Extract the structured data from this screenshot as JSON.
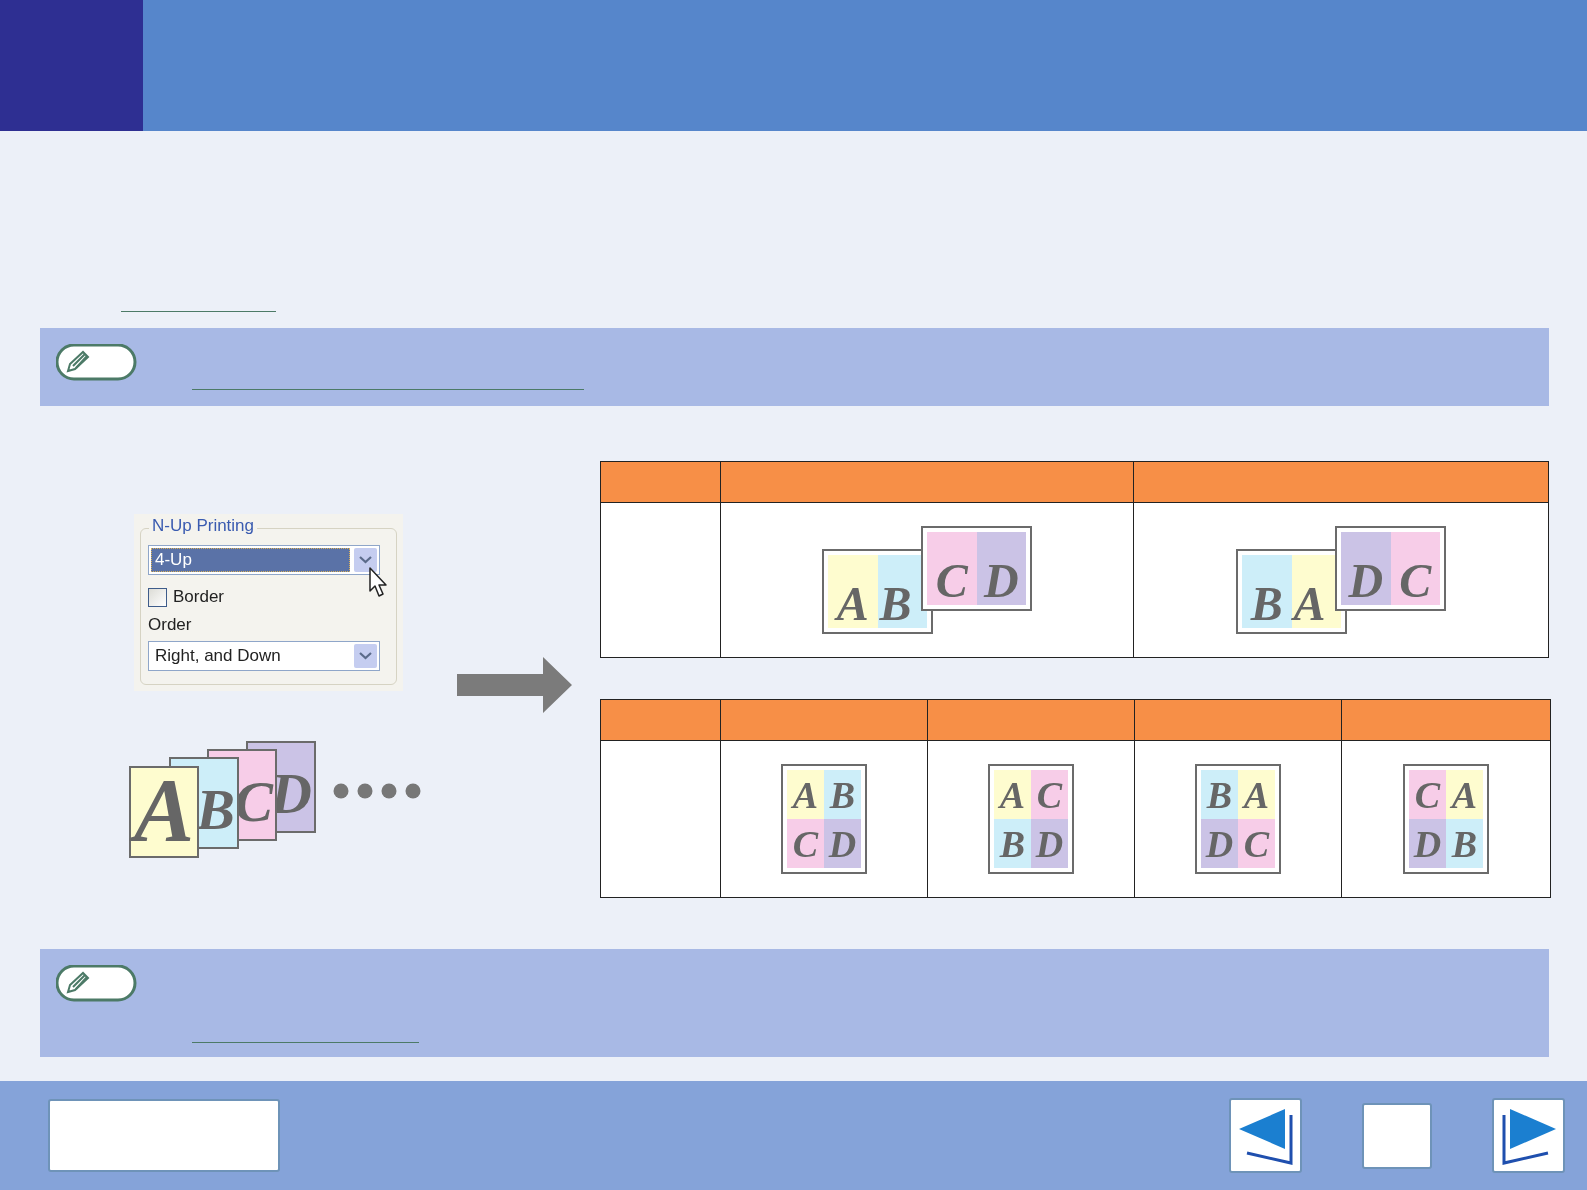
{
  "dialog": {
    "legend": "N-Up Printing",
    "n_up": {
      "value": "4-Up"
    },
    "border": {
      "label": "Border",
      "checked": false
    },
    "order_label": "Order",
    "order": {
      "value": "Right, and Down"
    }
  },
  "stack": [
    {
      "letter": "A",
      "color": "#fefccf"
    },
    {
      "letter": "B",
      "color": "#cdeef9"
    },
    {
      "letter": "C",
      "color": "#f7cde8"
    },
    {
      "letter": "D",
      "color": "#cbc3e6"
    }
  ],
  "tables": [
    {
      "columns": [
        {
          "kind": "blank"
        },
        {
          "kind": "landscape",
          "sheets": [
            [
              {
                "letter": "A",
                "color": "#fefccf"
              },
              {
                "letter": "B",
                "color": "#cdeef9"
              }
            ],
            [
              {
                "letter": "C",
                "color": "#f7cde8"
              },
              {
                "letter": "D",
                "color": "#cbc3e6"
              }
            ]
          ]
        },
        {
          "kind": "landscape",
          "sheets": [
            [
              {
                "letter": "B",
                "color": "#cdeef9"
              },
              {
                "letter": "A",
                "color": "#fefccf"
              }
            ],
            [
              {
                "letter": "D",
                "color": "#cbc3e6"
              },
              {
                "letter": "C",
                "color": "#f7cde8"
              }
            ]
          ]
        }
      ]
    },
    {
      "columns": [
        {
          "kind": "blank"
        },
        {
          "kind": "portrait",
          "cells": [
            {
              "letter": "A",
              "color": "#fefccf"
            },
            {
              "letter": "B",
              "color": "#cdeef9"
            },
            {
              "letter": "C",
              "color": "#f7cde8"
            },
            {
              "letter": "D",
              "color": "#cbc3e6"
            }
          ]
        },
        {
          "kind": "portrait",
          "cells": [
            {
              "letter": "A",
              "color": "#fefccf"
            },
            {
              "letter": "C",
              "color": "#f7cde8"
            },
            {
              "letter": "B",
              "color": "#cdeef9"
            },
            {
              "letter": "D",
              "color": "#cbc3e6"
            }
          ]
        },
        {
          "kind": "portrait",
          "cells": [
            {
              "letter": "B",
              "color": "#cdeef9"
            },
            {
              "letter": "A",
              "color": "#fefccf"
            },
            {
              "letter": "D",
              "color": "#cbc3e6"
            },
            {
              "letter": "C",
              "color": "#f7cde8"
            }
          ]
        },
        {
          "kind": "portrait",
          "cells": [
            {
              "letter": "C",
              "color": "#f7cde8"
            },
            {
              "letter": "A",
              "color": "#fefccf"
            },
            {
              "letter": "D",
              "color": "#cbc3e6"
            },
            {
              "letter": "B",
              "color": "#cdeef9"
            }
          ]
        }
      ]
    }
  ]
}
